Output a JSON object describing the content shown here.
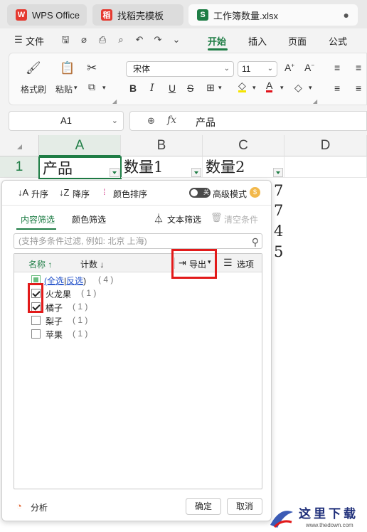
{
  "tabs": [
    {
      "label": "WPS Office",
      "logo": "W",
      "color": "#e5392f"
    },
    {
      "label": "找稻壳模板",
      "logo": "稻",
      "color": "#e5392f"
    },
    {
      "label": "工作簿数量.xlsx",
      "logo": "S",
      "color": "#1e7d45"
    }
  ],
  "menu": {
    "file": "文件",
    "items": [
      "开始",
      "插入",
      "页面",
      "公式"
    ],
    "active": "开始"
  },
  "ribbon": {
    "format_painter": "格式刷",
    "paste": "粘贴",
    "font_name": "宋体",
    "font_size": "11"
  },
  "formula_bar": {
    "cell_ref": "A1",
    "fx": "fx",
    "value": "产品"
  },
  "sheet": {
    "columns": [
      "A",
      "B",
      "C",
      "D"
    ],
    "rows": [
      "1"
    ],
    "header_cells": [
      "产品",
      "数量1",
      "数量2"
    ],
    "visible_col_c_values": [
      "7",
      "7",
      "4",
      "5"
    ]
  },
  "filter_panel": {
    "sort_asc": "升序",
    "sort_desc": "降序",
    "color_sort": "颜色排序",
    "advanced_mode": "高级模式",
    "toggle_label": "关",
    "tab_content": "内容筛选",
    "tab_color": "颜色筛选",
    "text_filter": "文本筛选",
    "clear_conditions": "清空条件",
    "search_placeholder": "(支持多条件过滤, 例如: 北京  上海)",
    "col_name": "名称",
    "col_count": "计数",
    "export": "导出",
    "options": "选项",
    "select_all_prefix": "(全选",
    "invert": "反选",
    "select_all_suffix": ")",
    "select_all_count": "( 4 )",
    "items": [
      {
        "label": "火龙果",
        "count": "( 1 )",
        "checked": true
      },
      {
        "label": "橘子",
        "count": "( 1 )",
        "checked": true
      },
      {
        "label": "梨子",
        "count": "( 1 )",
        "checked": false
      },
      {
        "label": "苹果",
        "count": "( 1 )",
        "checked": false
      }
    ],
    "analysis": "分析",
    "ok": "确定",
    "cancel": "取消"
  },
  "watermark": {
    "text": "这里下载",
    "url": "www.thedown.com"
  },
  "colors": {
    "accent": "#1e7d45",
    "highlight": "#e21a1a"
  }
}
